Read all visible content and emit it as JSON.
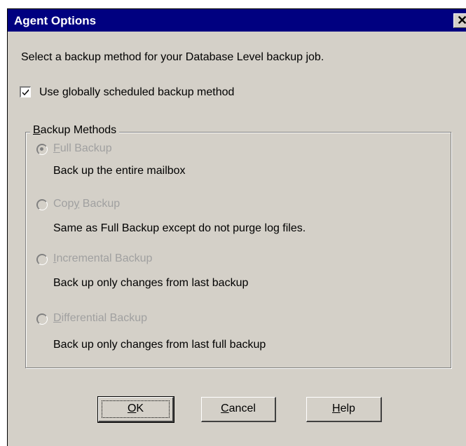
{
  "window": {
    "title": "Agent Options",
    "close_glyph": "✕"
  },
  "instruction": "Select a backup method for your Database Level backup job.",
  "use_global": {
    "label": "Use globally scheduled backup method",
    "checked": true
  },
  "group": {
    "label": "Backup Methods",
    "options": [
      {
        "label": "Full Backup",
        "accel": "F",
        "rest": "ull Backup",
        "description": "Back up the entire mailbox",
        "selected": true,
        "enabled": false
      },
      {
        "label": "Copy Backup",
        "accel": "y",
        "pre": "Cop",
        "rest": " Backup",
        "description": "Same as Full Backup except do not purge log files.",
        "selected": false,
        "enabled": false
      },
      {
        "label": "Incremental Backup",
        "accel": "I",
        "rest": "ncremental Backup",
        "description": "Back up only changes from last backup",
        "selected": false,
        "enabled": false
      },
      {
        "label": "Differential Backup",
        "accel": "D",
        "rest": "ifferential Backup",
        "description": "Back up only changes from last full backup",
        "selected": false,
        "enabled": false
      }
    ]
  },
  "buttons": {
    "ok": {
      "accel": "O",
      "rest": "K"
    },
    "cancel": {
      "accel": "C",
      "rest": "ancel"
    },
    "help": {
      "accel": "H",
      "rest": "elp"
    }
  }
}
